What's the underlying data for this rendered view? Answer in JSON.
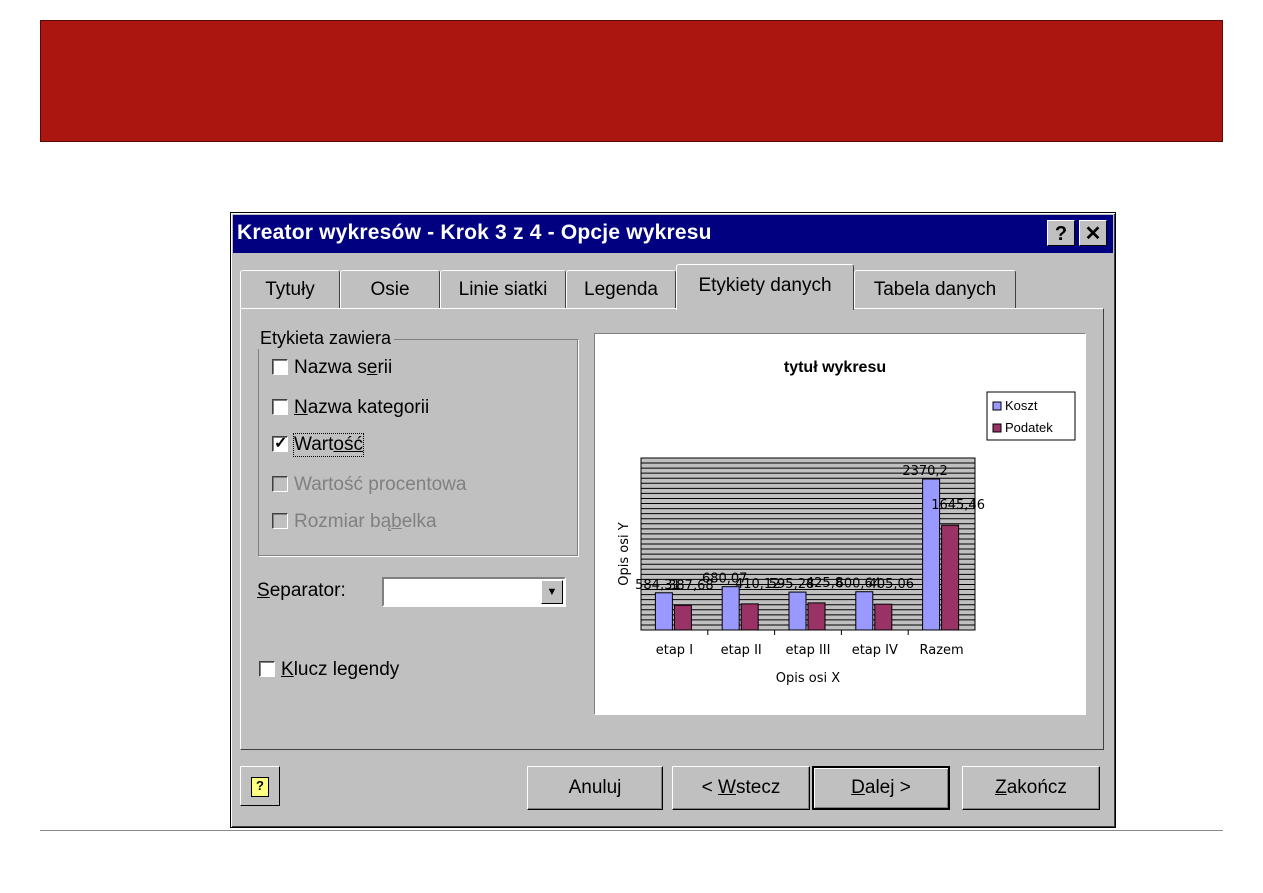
{
  "dialog": {
    "title": "Kreator wykresów - Krok 3 z 4 - Opcje wykresu",
    "help_glyph": "?",
    "close_glyph": "✕"
  },
  "tabs": [
    {
      "label": "Tytuły",
      "active": false
    },
    {
      "label": "Osie",
      "active": false
    },
    {
      "label": "Linie siatki",
      "active": false
    },
    {
      "label": "Legenda",
      "active": false
    },
    {
      "label": "Etykiety danych",
      "active": true
    },
    {
      "label": "Tabela danych",
      "active": false
    }
  ],
  "label_group": {
    "title": "Etykieta zawiera",
    "options": [
      {
        "pre": "Nazwa s",
        "u": "e",
        "post": "rii",
        "checked": false,
        "enabled": true
      },
      {
        "pre": "",
        "u": "N",
        "post": "azwa kategorii",
        "checked": false,
        "enabled": true
      },
      {
        "pre": "Wart",
        "u": "ość",
        "post": "",
        "checked": true,
        "enabled": true
      },
      {
        "pre": "Wartość procentowa",
        "u": "",
        "post": "",
        "checked": false,
        "enabled": false
      },
      {
        "pre": "Rozmiar bą",
        "u": "b",
        "post": "elka",
        "checked": false,
        "enabled": false
      }
    ]
  },
  "separator": {
    "u": "S",
    "rest": "eparator:",
    "value": ""
  },
  "legend_key": {
    "u": "K",
    "rest": "lucz legendy",
    "checked": false
  },
  "buttons": {
    "cancel": "Anuluj",
    "back_pre": "< ",
    "back_u": "W",
    "back_post": "stecz",
    "next_u": "D",
    "next_post": "alej >",
    "finish_u": "Z",
    "finish_post": "akończ"
  },
  "chart_data": {
    "type": "bar",
    "title": "tytuł wykresu",
    "xlabel": "Opis osi X",
    "ylabel": "Opis osi Y",
    "categories": [
      "etap I",
      "etap II",
      "etap III",
      "etap IV",
      "Razem"
    ],
    "series": [
      {
        "name": "Koszt",
        "color": "#9999ff",
        "values": [
          584.31,
          680.07,
          595.28,
          600.64,
          2370.2
        ],
        "labels": [
          "584,31",
          "680,07",
          "595,28",
          "600,64",
          "2370,2"
        ]
      },
      {
        "name": "Podatek",
        "color": "#993366",
        "values": [
          387.68,
          410.12,
          425.8,
          405.06,
          1645.46
        ],
        "labels": [
          "387,68",
          "410,12",
          "425,8",
          "405,06",
          "1645,46"
        ]
      }
    ],
    "ylim": [
      0,
      2700
    ],
    "grid": true,
    "legend": "right"
  }
}
